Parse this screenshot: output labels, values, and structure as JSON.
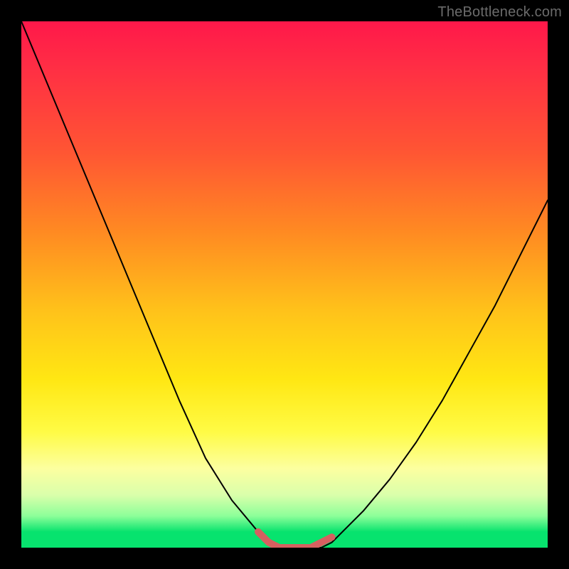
{
  "watermark": "TheBottleneck.com",
  "chart_data": {
    "type": "line",
    "title": "",
    "xlabel": "",
    "ylabel": "",
    "xlim": [
      0,
      100
    ],
    "ylim": [
      0,
      100
    ],
    "x": [
      0,
      5,
      10,
      15,
      20,
      25,
      30,
      35,
      40,
      45,
      47,
      49,
      51,
      53,
      55,
      57,
      59,
      60,
      65,
      70,
      75,
      80,
      85,
      90,
      95,
      100
    ],
    "values": [
      100,
      88,
      76,
      64,
      52,
      40,
      28,
      17,
      9,
      3,
      1,
      0,
      0,
      0,
      0,
      0,
      1,
      2,
      7,
      13,
      20,
      28,
      37,
      46,
      56,
      66
    ],
    "marker_segment": {
      "x": [
        45,
        47,
        49,
        51,
        53,
        55,
        57,
        59
      ],
      "values": [
        3,
        1,
        0,
        0,
        0,
        0,
        1,
        2
      ]
    },
    "colors": {
      "curve": "#000000",
      "marker": "#d66060",
      "background_top": "#ff184a",
      "background_bottom": "#07e36e",
      "frame": "#000000"
    }
  }
}
